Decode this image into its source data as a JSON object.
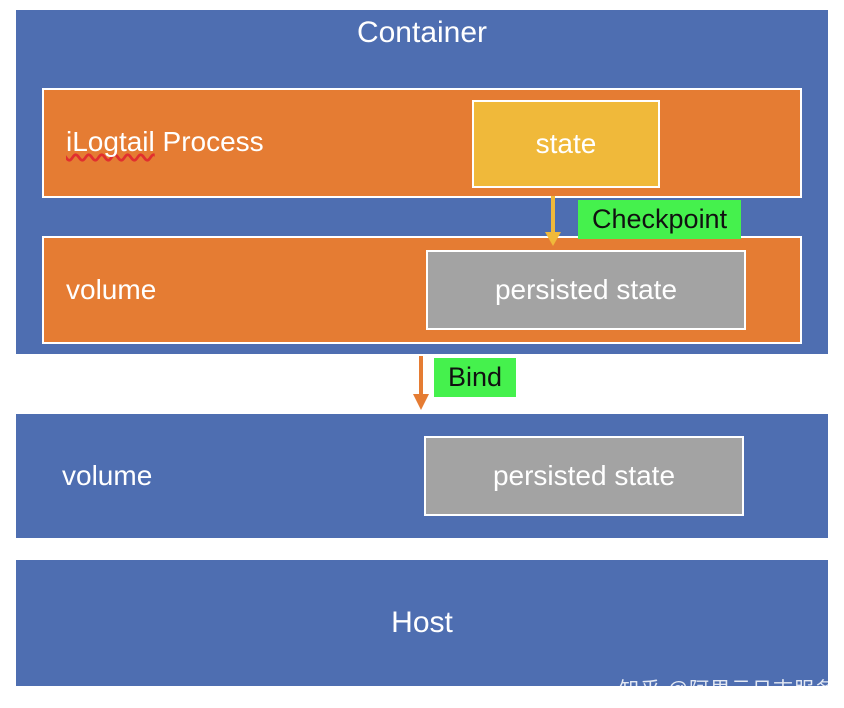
{
  "container": {
    "title": "Container",
    "process": {
      "label_prefix": "iLogtail",
      "label_suffix": " Process",
      "state_label": "state"
    },
    "volume": {
      "label": "volume",
      "persisted_label": "persisted state"
    }
  },
  "arrows": {
    "checkpoint_label": "Checkpoint",
    "bind_label": "Bind"
  },
  "host_volume": {
    "label": "volume",
    "persisted_label": "persisted state"
  },
  "host": {
    "label": "Host"
  },
  "attribution": "知乎 @阿里云日志服务"
}
